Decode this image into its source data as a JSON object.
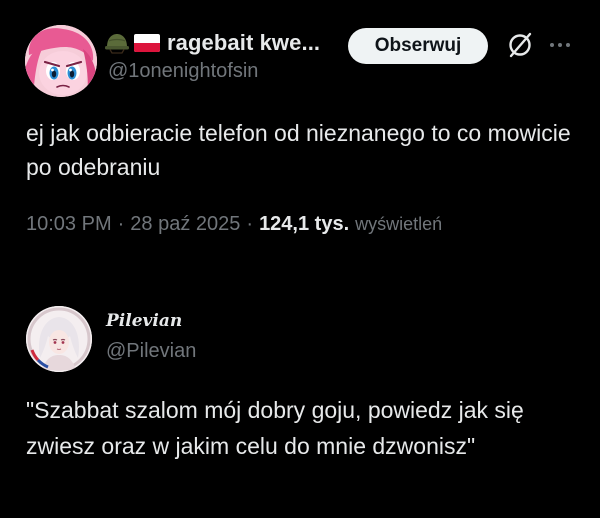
{
  "post1": {
    "author": {
      "display_name": "ragebait kwe...",
      "handle": "@1onenightofsin",
      "name_emojis": [
        "military-helmet-icon",
        "poland-flag-icon"
      ]
    },
    "follow_label": "Obserwuj",
    "text": "ej jak odbieracie telefon od nieznanego to co mowicie po odebraniu",
    "time": "10:03 PM",
    "date": "28 paź 2025",
    "separator": "·",
    "views_count": "124,1 tys.",
    "views_label": "wyświetleń"
  },
  "post2": {
    "author": {
      "display_name": "Pilevian",
      "handle": "@Pilevian"
    },
    "text": "\"Szabbat szalom mój dobry goju, powiedz jak się zwiesz oraz w jakim celu do mnie dzwonisz\""
  },
  "colors": {
    "background": "#000000",
    "text_primary": "#e7e9ea",
    "text_secondary": "#71767b",
    "button_bg": "#eff3f4",
    "button_text": "#0f1419"
  }
}
